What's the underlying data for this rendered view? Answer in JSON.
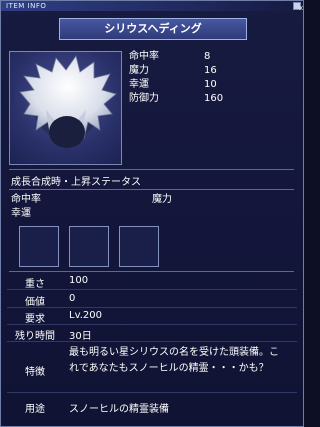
{
  "window": {
    "title": "ITEM INFO",
    "close_glyph": "x"
  },
  "item": {
    "name": "シリウスヘディング"
  },
  "stats": [
    {
      "label": "命中率",
      "value": "8"
    },
    {
      "label": "魔力",
      "value": "16"
    },
    {
      "label": "幸運",
      "value": "10"
    },
    {
      "label": "防御力",
      "value": "160"
    }
  ],
  "growth": {
    "title": "成長合成時・上昇ステータス",
    "items": [
      "命中率",
      "魔力",
      "幸運"
    ]
  },
  "details": {
    "weight": {
      "label": "重さ",
      "value": "100"
    },
    "price": {
      "label": "価値",
      "value": "0"
    },
    "requirement": {
      "label": "要求",
      "value": "Lv.200"
    },
    "remaining_time": {
      "label": "残り時間",
      "value": "30日"
    },
    "feature": {
      "label": "特徴",
      "line1": "最も明るい星シリウスの名を受けた頭装備。こ",
      "line2": "れであなたもスノーヒルの精霊・・・かも？"
    },
    "usage": {
      "label": "用途",
      "value": "スノーヒルの精霊装備"
    }
  }
}
